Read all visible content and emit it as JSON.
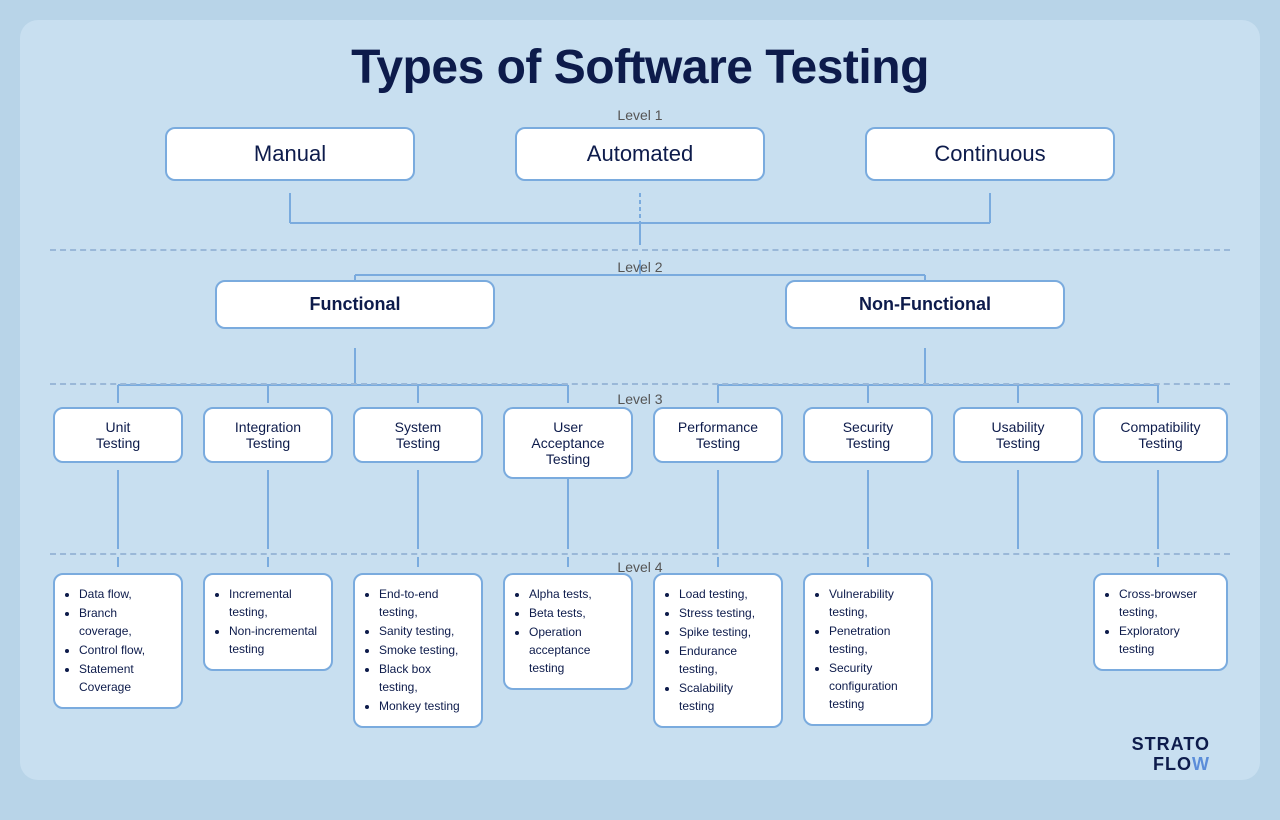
{
  "title": "Types of Software Testing",
  "level_labels": {
    "l1": "Level 1",
    "l2": "Level 2",
    "l3": "Level 3",
    "l4": "Level 4"
  },
  "level1": {
    "nodes": [
      "Manual",
      "Automated",
      "Continuous"
    ]
  },
  "level2": {
    "nodes": [
      "Functional",
      "Non-Functional"
    ]
  },
  "level3": {
    "nodes": [
      "Unit\nTesting",
      "Integration\nTesting",
      "System\nTesting",
      "User\nAcceptance\nTesting",
      "Performance\nTesting",
      "Security\nTesting",
      "Usability\nTesting",
      "Compatibility\nTesting"
    ]
  },
  "level4": {
    "nodes": [
      {
        "id": "unit",
        "items": [
          "Data flow,",
          "Branch coverage,",
          "Control flow,",
          "Statement Coverage"
        ]
      },
      {
        "id": "integration",
        "items": [
          "Incremental testing,",
          "Non-incremental testing"
        ]
      },
      {
        "id": "system",
        "items": [
          "End-to-end testing,",
          "Sanity testing,",
          "Smoke testing,",
          "Black box testing,",
          "Monkey testing"
        ]
      },
      {
        "id": "uat",
        "items": [
          "Alpha tests,",
          "Beta tests,",
          "Operation acceptance testing"
        ]
      },
      {
        "id": "performance",
        "items": [
          "Load testing,",
          "Stress testing,",
          "Spike testing,",
          "Endurance testing,",
          "Scalability testing"
        ]
      },
      {
        "id": "security",
        "items": [
          "Vulnerability testing,",
          "Penetration testing,",
          "Security configuration testing"
        ]
      },
      {
        "id": "usability",
        "placeholder": true
      },
      {
        "id": "compatibility",
        "items": [
          "Cross-browser testing,",
          "Exploratory testing"
        ]
      }
    ]
  },
  "brand": {
    "line1": "STRATO",
    "line2_part1": "FLO",
    "line2_part2": "W"
  }
}
